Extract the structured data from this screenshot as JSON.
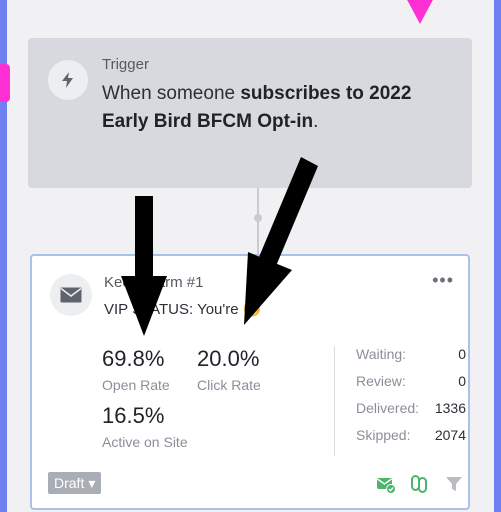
{
  "trigger": {
    "label": "Trigger",
    "text_prefix": "When someone ",
    "text_bold": "subscribes to 2022 Early Bird BFCM Opt-in",
    "text_suffix": "."
  },
  "email": {
    "name": "Keep Warm #1",
    "subject": "VIP STATUS: You're 😊",
    "more": "•••",
    "stats": {
      "open_rate_value": "69.8%",
      "open_rate_label": "Open Rate",
      "click_rate_value": "20.0%",
      "click_rate_label": "Click Rate",
      "active_value": "16.5%",
      "active_label": "Active on Site"
    },
    "side_stats": [
      {
        "label": "Waiting:",
        "value": "0"
      },
      {
        "label": "Review:",
        "value": "0"
      },
      {
        "label": "Delivered:",
        "value": "1336"
      },
      {
        "label": "Skipped:",
        "value": "2074"
      }
    ],
    "status_badge": "Draft",
    "status_caret": "▾"
  },
  "colors": {
    "background": "#6f80f2",
    "annotation_pink": "#ff2fd6",
    "email_icon_green": "#4cb46b",
    "card_border": "#a9c2ea"
  },
  "icons": {
    "trigger": "bolt-icon",
    "email": "envelope-icon",
    "footer": [
      "email-check-icon",
      "link-icon",
      "filter-icon"
    ]
  }
}
